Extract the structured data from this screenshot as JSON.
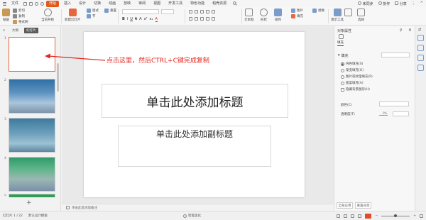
{
  "menubar": {
    "file": "文件",
    "tabs": [
      "开始",
      "插入",
      "设计",
      "切换",
      "动画",
      "放映",
      "审阅",
      "视图",
      "开发工具",
      "特色功能",
      "稻壳资源"
    ],
    "active_tab": "开始",
    "right": [
      "未同步",
      "协作",
      "分享"
    ]
  },
  "ribbon": {
    "paste": "粘贴",
    "cut": "剪切",
    "copy": "复制",
    "format_painter": "格式刷",
    "from_current": "当前开始",
    "new_slide": "新建幻灯片",
    "layout": "版式",
    "section": "节",
    "reset": "重置",
    "textbox": "文本框",
    "shape": "形状",
    "arrange": "排列",
    "picture": "图片",
    "fill": "填充",
    "replace": "替换",
    "select": "选择",
    "presenter_tools": "演示工具",
    "format_chars": [
      "B",
      "I",
      "U",
      "S",
      "A",
      "x²",
      "x₂",
      "A"
    ]
  },
  "leftpanel": {
    "tabs": [
      "大纲",
      "幻灯片"
    ],
    "active_tab": "幻灯片",
    "slide_numbers": [
      "1",
      "2",
      "3",
      "4",
      "5"
    ],
    "add_button": "+"
  },
  "slide": {
    "title_placeholder": "单击此处添加标题",
    "subtitle_placeholder": "单击此处添加副标题",
    "annotation": "点击这里，然后CTRL+C键完成复制",
    "annotation_color": "#e5261f"
  },
  "notes": {
    "placeholder": "单击此处添加备注"
  },
  "rightpanel": {
    "title": "对象属性",
    "tab": "填充",
    "section": "填充",
    "options": [
      "纯色填充(S)",
      "渐变填充(G)",
      "图片或纹理填充(P)",
      "图案填充(A)",
      "隐藏背景图形(H)"
    ],
    "selected_option": 0,
    "color_label": "颜色(C)",
    "transparency_label": "透明度(T)",
    "transparency_value": "0%",
    "apply_all": "全部应用",
    "reset_background": "重置背景"
  },
  "statusbar": {
    "slide_count": "幻灯片 1 / 22",
    "theme": "默认设计模板",
    "beautify": "智能美化",
    "accent": "#e24a2b"
  }
}
